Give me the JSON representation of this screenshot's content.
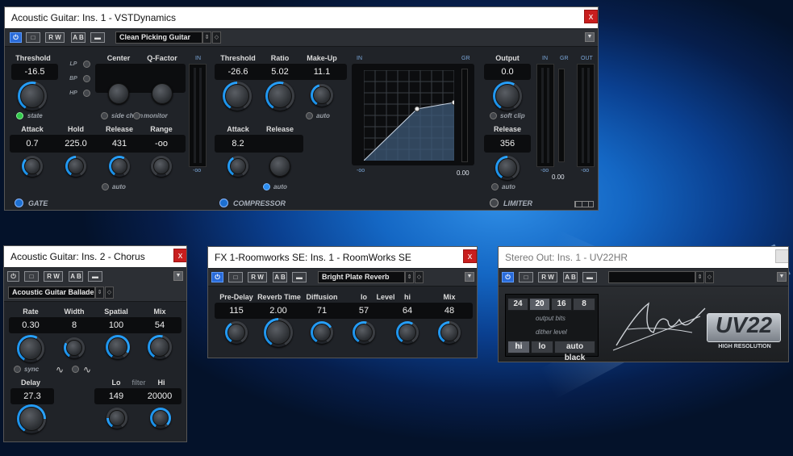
{
  "vstdynamics": {
    "title": "Acoustic Guitar: Ins. 1 - VSTDynamics",
    "close": "x",
    "toolbar": {
      "preset": "Clean Picking Guitar",
      "rw": "R W",
      "ab": "A B"
    },
    "gate": {
      "label": "GATE",
      "threshold": {
        "label": "Threshold",
        "value": "-16.5",
        "knob": 0.55
      },
      "center": {
        "label": "Center"
      },
      "qfactor": {
        "label": "Q-Factor"
      },
      "filters": [
        "LP",
        "BP",
        "HP"
      ],
      "state": "state",
      "side_chain": "side chain",
      "monitor": "monitor",
      "attack": {
        "label": "Attack",
        "value": "0.7",
        "knob": 0.35
      },
      "hold": {
        "label": "Hold",
        "value": "225.0",
        "knob": 0.5
      },
      "release": {
        "label": "Release",
        "value": "431",
        "knob": 0.6
      },
      "range": {
        "label": "Range",
        "value": "-oo",
        "knob": 0.0
      },
      "auto": "auto",
      "meter_in": "IN",
      "meter_val": "-oo"
    },
    "compressor": {
      "label": "COMPRESSOR",
      "threshold": {
        "label": "Threshold",
        "value": "-26.6",
        "knob": 0.5
      },
      "ratio": {
        "label": "Ratio",
        "value": "5.02",
        "knob": 0.55
      },
      "makeup": {
        "label": "Make-Up",
        "value": "11.1",
        "knob": 0.45
      },
      "attack": {
        "label": "Attack",
        "value": "8.2",
        "knob": 0.4
      },
      "release": {
        "label": "Release",
        "knob": 0.0
      },
      "auto": "auto",
      "graph_in": "IN",
      "graph_gr": "GR",
      "graph_min": "-oo",
      "graph_val": "0.00"
    },
    "limiter": {
      "label": "LIMITER",
      "output": {
        "label": "Output",
        "value": "0.0",
        "knob": 0.6
      },
      "release": {
        "label": "Release",
        "value": "356",
        "knob": 0.5
      },
      "soft_clip": "soft clip",
      "auto": "auto",
      "meters": {
        "in": "IN",
        "gr": "GR",
        "out": "OUT",
        "in_val": "-oo",
        "gr_val": "0.00",
        "out_val": "-oo"
      }
    }
  },
  "chorus": {
    "title": "Acoustic Guitar: Ins. 2 - Chorus",
    "close": "x",
    "preset": "Acoustic Guitar Ballade",
    "rate": {
      "label": "Rate",
      "value": "0.30",
      "knob": 0.6
    },
    "width": {
      "label": "Width",
      "value": "8",
      "knob": 0.3
    },
    "spatial": {
      "label": "Spatial",
      "value": "100",
      "knob": 0.9
    },
    "mix": {
      "label": "Mix",
      "value": "54",
      "knob": 0.55
    },
    "sync": "sync",
    "delay": {
      "label": "Delay",
      "value": "27.3",
      "knob": 0.8
    },
    "lo": {
      "label": "Lo",
      "value": "149",
      "knob": 0.2
    },
    "filter": "filter",
    "hi": {
      "label": "Hi",
      "value": "20000",
      "knob": 0.95
    }
  },
  "roomworks": {
    "title": "FX 1-Roomworks SE: Ins. 1 - RoomWorks SE",
    "close": "x",
    "preset": "Bright Plate Reverb",
    "predelay": {
      "label": "Pre-Delay",
      "value": "115",
      "knob": 0.4
    },
    "reverbtime": {
      "label": "Reverb Time",
      "value": "2.00",
      "knob": 0.5
    },
    "diffusion": {
      "label": "Diffusion",
      "value": "71",
      "knob": 0.7
    },
    "level_lo": {
      "label": "lo",
      "value": "57",
      "knob": 0.55
    },
    "level_label": "Level",
    "level_hi": {
      "label": "hi",
      "value": "64",
      "knob": 0.6
    },
    "mix": {
      "label": "Mix",
      "value": "48",
      "knob": 0.5
    }
  },
  "uv22": {
    "title": "Stereo Out: Ins. 1 - UV22HR",
    "bits": [
      "24",
      "20",
      "16",
      "8"
    ],
    "selected_bits": "20",
    "output_bits": "output bits",
    "dither_level": "dither level",
    "dither": [
      "hi",
      "lo",
      "auto black"
    ],
    "selected_dither": "hi",
    "logo": "UV22",
    "logo_sub": "HIGH RESOLUTION",
    "signature": "APOGEE"
  },
  "colors": {
    "accent": "#2aa3ff",
    "close": "#c81e1e"
  }
}
